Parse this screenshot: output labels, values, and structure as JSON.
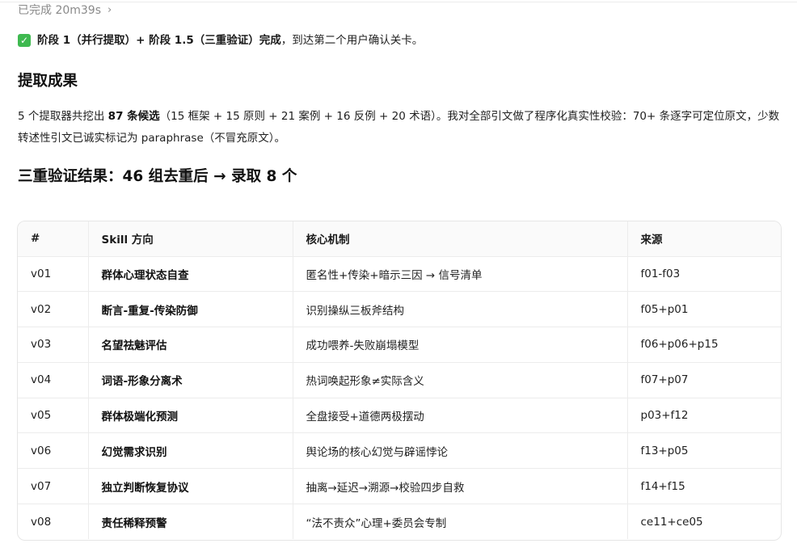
{
  "status": {
    "label": "已完成 20m39s",
    "chevron_icon": "chevron-right-icon"
  },
  "summary": {
    "icon": "check-mark-icon",
    "bold_text": "阶段 1（并行提取）+ 阶段 1.5（三重验证）完成",
    "rest_text": "，到达第二个用户确认关卡。"
  },
  "section1": {
    "title": "提取成果"
  },
  "paragraph": {
    "part1": "5 个提取器共挖出 ",
    "bold": "87 条候选",
    "part2": "（15 框架 + 15 原则 + 21 案例 + 16 反例 + 20 术语）。我对全部引文做了程序化真实性校验：70+ 条逐字可定位原文，少数转述性引文已诚实标记为 paraphrase（不冒充原文）。"
  },
  "section2": {
    "title": "三重验证结果：46 组去重后 → 录取 8 个"
  },
  "table": {
    "headers": [
      "#",
      "Skill 方向",
      "核心机制",
      "来源"
    ],
    "rows": [
      [
        "v01",
        "群体心理状态自查",
        "匿名性+传染+暗示三因 → 信号清单",
        "f01-f03"
      ],
      [
        "v02",
        "断言-重复-传染防御",
        "识别操纵三板斧结构",
        "f05+p01"
      ],
      [
        "v03",
        "名望祛魅评估",
        "成功喂养-失败崩塌模型",
        "f06+p06+p15"
      ],
      [
        "v04",
        "词语-形象分离术",
        "热词唤起形象≠实际含义",
        "f07+p07"
      ],
      [
        "v05",
        "群体极端化预测",
        "全盘接受+道德两极摆动",
        "p03+f12"
      ],
      [
        "v06",
        "幻觉需求识别",
        "舆论场的核心幻觉与辟谣悖论",
        "f13+p05"
      ],
      [
        "v07",
        "独立判断恢复协议",
        "抽离→延迟→溯源→校验四步自救",
        "f14+f15"
      ],
      [
        "v08",
        "责任稀释预警",
        "“法不责众”心理+委员会专制",
        "ce11+ce05"
      ]
    ]
  }
}
